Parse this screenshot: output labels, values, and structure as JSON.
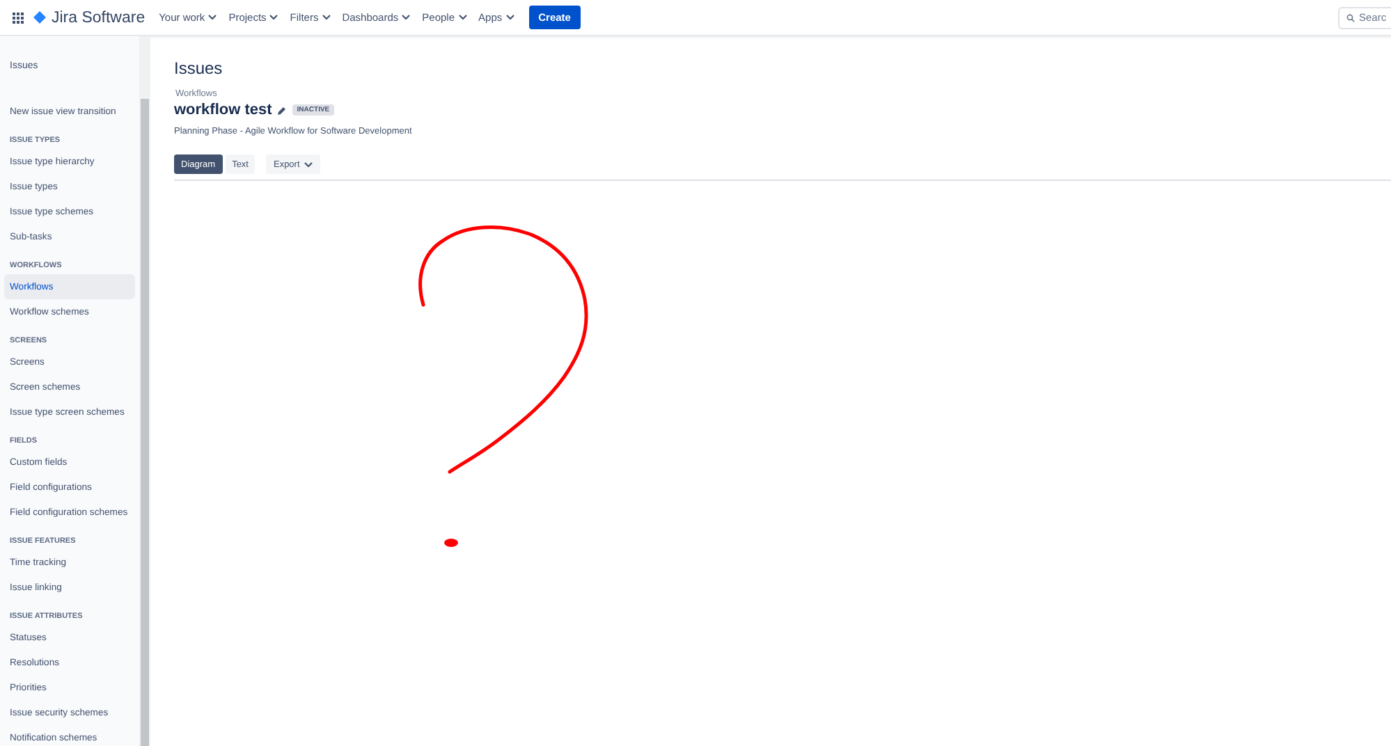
{
  "topbar": {
    "product": "Jira Software",
    "menus": [
      {
        "label": "Your work"
      },
      {
        "label": "Projects"
      },
      {
        "label": "Filters"
      },
      {
        "label": "Dashboards"
      },
      {
        "label": "People"
      },
      {
        "label": "Apps"
      }
    ],
    "create": "Create",
    "search": {
      "placeholder": "Searc"
    }
  },
  "sidebar": {
    "title": "Issues",
    "items": [
      {
        "label": "New issue view transition",
        "selected": false
      }
    ],
    "sections": [
      {
        "heading": "ISSUE TYPES",
        "items": [
          {
            "label": "Issue type hierarchy",
            "selected": false
          },
          {
            "label": "Issue types",
            "selected": false
          },
          {
            "label": "Issue type schemes",
            "selected": false
          },
          {
            "label": "Sub-tasks",
            "selected": false
          }
        ]
      },
      {
        "heading": "WORKFLOWS",
        "items": [
          {
            "label": "Workflows",
            "selected": true
          },
          {
            "label": "Workflow schemes",
            "selected": false
          }
        ]
      },
      {
        "heading": "SCREENS",
        "items": [
          {
            "label": "Screens",
            "selected": false
          },
          {
            "label": "Screen schemes",
            "selected": false
          },
          {
            "label": "Issue type screen schemes",
            "selected": false
          }
        ]
      },
      {
        "heading": "FIELDS",
        "items": [
          {
            "label": "Custom fields",
            "selected": false
          },
          {
            "label": "Field configurations",
            "selected": false
          },
          {
            "label": "Field configuration schemes",
            "selected": false
          }
        ]
      },
      {
        "heading": "ISSUE FEATURES",
        "items": [
          {
            "label": "Time tracking",
            "selected": false
          },
          {
            "label": "Issue linking",
            "selected": false
          }
        ]
      },
      {
        "heading": "ISSUE ATTRIBUTES",
        "items": [
          {
            "label": "Statuses",
            "selected": false
          },
          {
            "label": "Resolutions",
            "selected": false
          },
          {
            "label": "Priorities",
            "selected": false
          },
          {
            "label": "Issue security schemes",
            "selected": false
          },
          {
            "label": "Notification schemes",
            "selected": false
          }
        ]
      }
    ]
  },
  "main": {
    "title": "Issues",
    "breadcrumb": "Workflows",
    "workflow_name": "workflow test",
    "status": "INACTIVE",
    "description": "Planning Phase - Agile Workflow for Software Development",
    "view_tabs": [
      {
        "label": "Diagram",
        "selected": true
      },
      {
        "label": "Text",
        "selected": false
      }
    ],
    "export": "Export"
  }
}
